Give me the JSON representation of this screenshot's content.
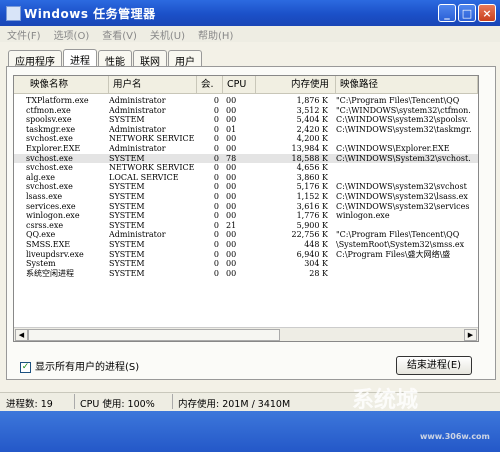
{
  "window": {
    "title": "Windows 任务管理器",
    "min": "_",
    "max": "□",
    "close": "×"
  },
  "menu": [
    "文件(F)",
    "选项(O)",
    "查看(V)",
    "关机(U)",
    "帮助(H)"
  ],
  "tabs": [
    {
      "label": "应用程序",
      "active": false
    },
    {
      "label": "进程",
      "active": true
    },
    {
      "label": "性能",
      "active": false
    },
    {
      "label": "联网",
      "active": false
    },
    {
      "label": "用户",
      "active": false
    }
  ],
  "columns": {
    "name": "映像名称",
    "user": "用户名",
    "session": "会.",
    "cpu": "CPU",
    "mem": "内存使用",
    "path": "映像路径"
  },
  "processes": [
    {
      "name": "TXPlatform.exe",
      "user": "Administrator",
      "session": "0",
      "cpu": "00",
      "mem": "1,876 K",
      "path": "\"C:\\Program Files\\Tencent\\QQ"
    },
    {
      "name": "ctfmon.exe",
      "user": "Administrator",
      "session": "0",
      "cpu": "00",
      "mem": "3,512 K",
      "path": "\"C:\\WINDOWS\\system32\\ctfmon."
    },
    {
      "name": "spoolsv.exe",
      "user": "SYSTEM",
      "session": "0",
      "cpu": "00",
      "mem": "5,404 K",
      "path": "C:\\WINDOWS\\system32\\spoolsv."
    },
    {
      "name": "taskmgr.exe",
      "user": "Administrator",
      "session": "0",
      "cpu": "01",
      "mem": "2,420 K",
      "path": "C:\\WINDOWS\\system32\\taskmgr."
    },
    {
      "name": "svchost.exe",
      "user": "NETWORK SERVICE",
      "session": "0",
      "cpu": "00",
      "mem": "4,200 K",
      "path": ""
    },
    {
      "name": "Explorer.EXE",
      "user": "Administrator",
      "session": "0",
      "cpu": "00",
      "mem": "13,984 K",
      "path": "C:\\WINDOWS\\Explorer.EXE"
    },
    {
      "name": "svchost.exe",
      "user": "SYSTEM",
      "session": "0",
      "cpu": "78",
      "mem": "18,588 K",
      "path": "C:\\WINDOWS\\System32\\svchost.",
      "selected": true
    },
    {
      "name": "svchost.exe",
      "user": "NETWORK SERVICE",
      "session": "0",
      "cpu": "00",
      "mem": "4,656 K",
      "path": ""
    },
    {
      "name": "alg.exe",
      "user": "LOCAL SERVICE",
      "session": "0",
      "cpu": "00",
      "mem": "3,860 K",
      "path": ""
    },
    {
      "name": "svchost.exe",
      "user": "SYSTEM",
      "session": "0",
      "cpu": "00",
      "mem": "5,176 K",
      "path": "C:\\WINDOWS\\system32\\svchost"
    },
    {
      "name": "lsass.exe",
      "user": "SYSTEM",
      "session": "0",
      "cpu": "00",
      "mem": "1,152 K",
      "path": "C:\\WINDOWS\\system32\\lsass.ex"
    },
    {
      "name": "services.exe",
      "user": "SYSTEM",
      "session": "0",
      "cpu": "00",
      "mem": "3,616 K",
      "path": "C:\\WINDOWS\\system32\\services"
    },
    {
      "name": "winlogon.exe",
      "user": "SYSTEM",
      "session": "0",
      "cpu": "00",
      "mem": "1,776 K",
      "path": "winlogon.exe"
    },
    {
      "name": "csrss.exe",
      "user": "SYSTEM",
      "session": "0",
      "cpu": "21",
      "mem": "5,900 K",
      "path": ""
    },
    {
      "name": "QQ.exe",
      "user": "Administrator",
      "session": "0",
      "cpu": "00",
      "mem": "22,756 K",
      "path": "\"C:\\Program Files\\Tencent\\QQ"
    },
    {
      "name": "SMSS.EXE",
      "user": "SYSTEM",
      "session": "0",
      "cpu": "00",
      "mem": "448 K",
      "path": "\\SystemRoot\\System32\\smss.ex"
    },
    {
      "name": "liveupdsrv.exe",
      "user": "SYSTEM",
      "session": "0",
      "cpu": "00",
      "mem": "6,940 K",
      "path": "C:\\Program Files\\盛大网络\\盛"
    },
    {
      "name": "System",
      "user": "SYSTEM",
      "session": "0",
      "cpu": "00",
      "mem": "304 K",
      "path": ""
    },
    {
      "name": "系统空闲进程",
      "user": "SYSTEM",
      "session": "0",
      "cpu": "00",
      "mem": "28 K",
      "path": ""
    }
  ],
  "show_all": {
    "label": "显示所有用户的进程(S)",
    "checked": true
  },
  "end_process": "结束进程(E)",
  "status": {
    "processes": "进程数: 19",
    "cpu": "CPU 使用: 100%",
    "memory": "内存使用: 201M / 3410M"
  },
  "watermark": {
    "main": "系统城",
    "site": "www.306w.com"
  }
}
